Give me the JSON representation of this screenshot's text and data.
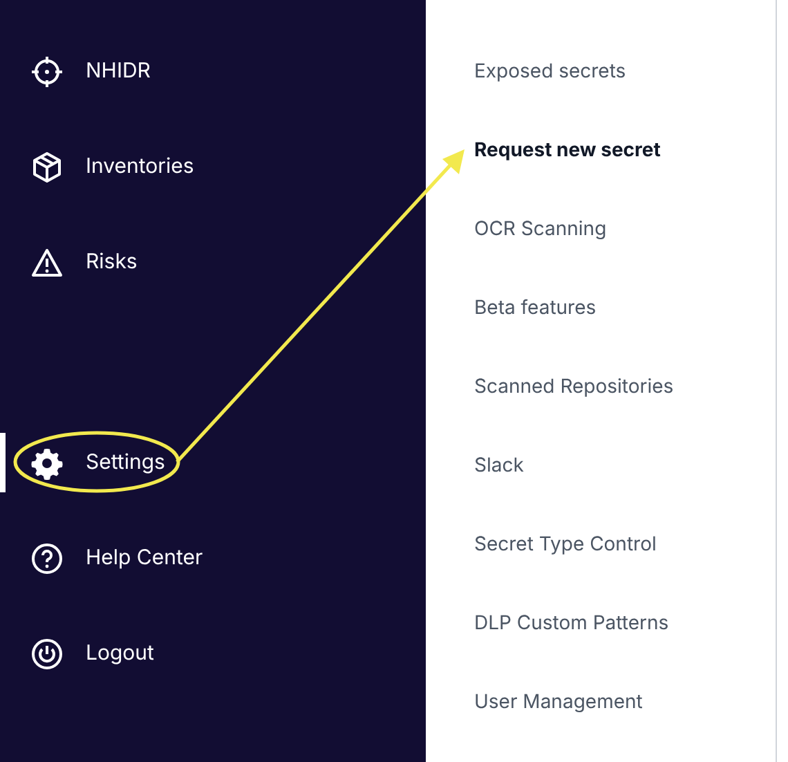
{
  "sidebar": {
    "items": [
      {
        "label": "NHIDR",
        "selected": false
      },
      {
        "label": "Inventories",
        "selected": false
      },
      {
        "label": "Risks",
        "selected": false
      },
      {
        "label": "Settings",
        "selected": true
      },
      {
        "label": "Help Center",
        "selected": false
      },
      {
        "label": "Logout",
        "selected": false
      }
    ]
  },
  "settings_menu": {
    "items": [
      {
        "label": "Exposed secrets",
        "selected": false
      },
      {
        "label": "Request new secret",
        "selected": true
      },
      {
        "label": "OCR Scanning",
        "selected": false
      },
      {
        "label": "Beta features",
        "selected": false
      },
      {
        "label": "Scanned Repositories",
        "selected": false
      },
      {
        "label": "Slack",
        "selected": false
      },
      {
        "label": "Secret Type Control",
        "selected": false
      },
      {
        "label": "DLP Custom Patterns",
        "selected": false
      },
      {
        "label": "User Management",
        "selected": false
      }
    ]
  }
}
